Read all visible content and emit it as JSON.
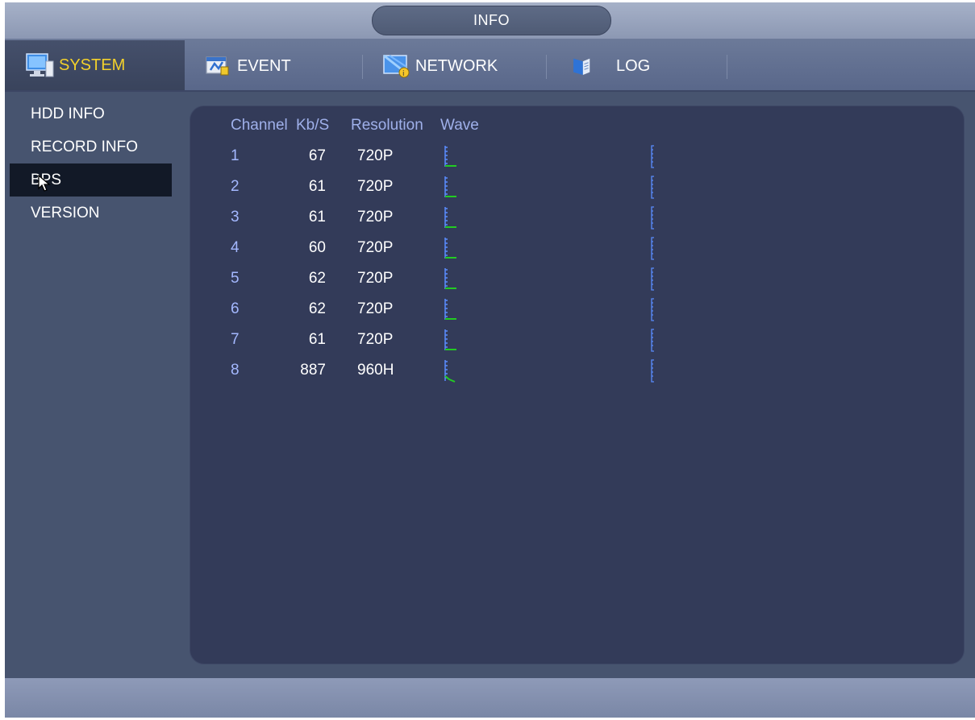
{
  "window": {
    "title": "INFO"
  },
  "tabs": [
    {
      "label": "SYSTEM",
      "icon": "monitor-icon",
      "active": true
    },
    {
      "label": "EVENT",
      "icon": "event-icon",
      "active": false
    },
    {
      "label": "NETWORK",
      "icon": "network-icon",
      "active": false
    },
    {
      "label": "LOG",
      "icon": "log-book-icon",
      "active": false
    }
  ],
  "sidebar": {
    "items": [
      {
        "label": "HDD INFO",
        "selected": false
      },
      {
        "label": "RECORD INFO",
        "selected": false
      },
      {
        "label": "BPS",
        "selected": true
      },
      {
        "label": "VERSION",
        "selected": false
      }
    ]
  },
  "table": {
    "headers": {
      "channel": "Channel",
      "kbs": "Kb/S",
      "resolution": "Resolution",
      "wave": "Wave"
    },
    "rows": [
      {
        "channel": "1",
        "kbs": "67",
        "resolution": "720P"
      },
      {
        "channel": "2",
        "kbs": "61",
        "resolution": "720P"
      },
      {
        "channel": "3",
        "kbs": "61",
        "resolution": "720P"
      },
      {
        "channel": "4",
        "kbs": "60",
        "resolution": "720P"
      },
      {
        "channel": "5",
        "kbs": "62",
        "resolution": "720P"
      },
      {
        "channel": "6",
        "kbs": "62",
        "resolution": "720P"
      },
      {
        "channel": "7",
        "kbs": "61",
        "resolution": "720P"
      },
      {
        "channel": "8",
        "kbs": "887",
        "resolution": "960H"
      }
    ]
  },
  "colors": {
    "accent_active_tab": "#f3d12b",
    "channel_text": "#a4b8ff",
    "header_text": "#9fb0ea",
    "wave_axis": "#5a8cff",
    "wave_line": "#22cc22",
    "panel_bg": "#333b59",
    "selected_item_bg": "#121927"
  }
}
